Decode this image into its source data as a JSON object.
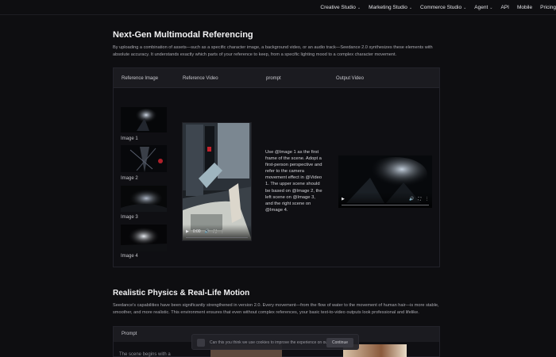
{
  "nav": {
    "items": [
      {
        "label": "Creative Studio",
        "dropdown": true
      },
      {
        "label": "Marketing Studio",
        "dropdown": true
      },
      {
        "label": "Commerce Studio",
        "dropdown": true
      },
      {
        "label": "Agent",
        "dropdown": true
      },
      {
        "label": "API",
        "dropdown": false
      },
      {
        "label": "Mobile",
        "dropdown": false
      },
      {
        "label": "Pricing",
        "dropdown": false
      }
    ]
  },
  "section1": {
    "title": "Next-Gen Multimodal Referencing",
    "description": "By uploading a combination of assets—such as a specific character image, a background video, or an audio track—Seedance 2.0 synthesizes these elements with absolute accuracy. It understands exactly which parts of your reference to keep, from a specific lighting mood to a complex character movement.",
    "table": {
      "headers": [
        "Reference Image",
        "Reference Video",
        "prompt",
        "Output Video"
      ],
      "images": [
        "Image 1",
        "Image 2",
        "Image 3",
        "Image 4"
      ],
      "prompt": "Use @Image 1 as the first frame of the scene. Adopt a first-person perspective and refer to the camera movement effect in @Video 1. The upper scene should be based on @Image 2, the left scene on @Image 3, and the right scene on @Image 4.",
      "video1": {
        "time": "0:00"
      },
      "video2": {
        "time": ""
      }
    }
  },
  "section2": {
    "title": "Realistic Physics & Real-Life Motion",
    "description": "Seedance's capabilities have been significantly strengthened in version 2.0. Every movement—from the flow of water to the movement of human hair—is more stable, smoother, and more realistic. This environment ensures that even without complex references, your basic text-to-video outputs look professional and lifelike.",
    "table": {
      "header": "Prompt",
      "row_text": "The scene begins with a"
    }
  },
  "cookie": {
    "text": "Can this you think we use cookies to improve the experience on our site",
    "button": "Continue"
  },
  "colors": {
    "background": "#0e0e11",
    "panel": "#0f0f13",
    "header": "#1b1b20",
    "text": "#d6d6da"
  }
}
